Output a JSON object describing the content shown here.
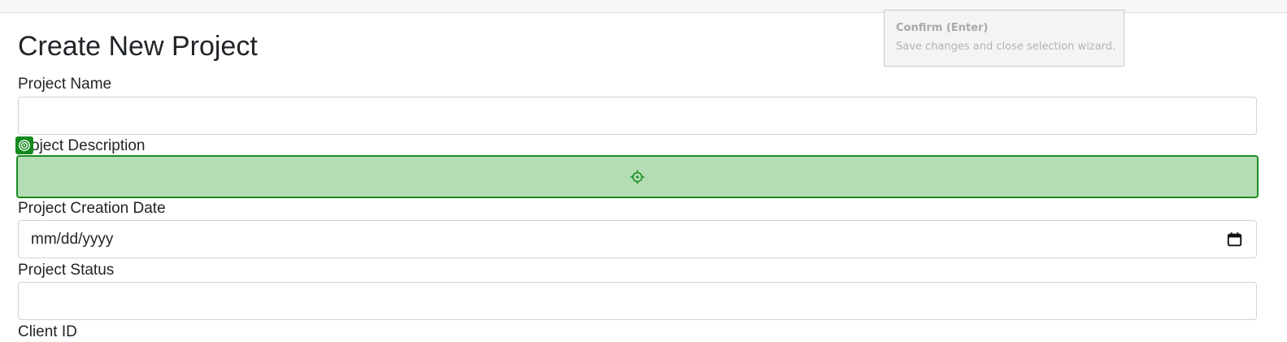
{
  "form": {
    "title": "Create New Project",
    "fields": [
      {
        "label": "Project Name",
        "value": ""
      },
      {
        "label": "oject Description",
        "value": ""
      },
      {
        "label": "Project Creation Date",
        "placeholder": "mm/dd/yyyy"
      },
      {
        "label": "Project Status",
        "value": ""
      },
      {
        "label": "Client ID"
      }
    ]
  },
  "tooltip": {
    "title": "Confirm (Enter)",
    "text": "Save changes and close selection wizard."
  },
  "icons": {
    "badge": "target-badge-icon",
    "crosshair": "crosshair-icon",
    "calendar": "calendar-icon"
  },
  "colors": {
    "highlight_fill": "#b4ddb4",
    "highlight_border": "#1a8c22"
  }
}
